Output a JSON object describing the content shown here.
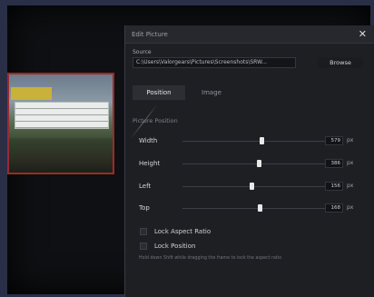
{
  "dialog": {
    "title": "Edit Picture",
    "close_icon": "close-icon",
    "source_label": "Source",
    "source_path": "C:\\Users\\Valorgears\\Pictures\\Screenshots\\SRW...",
    "browse_label": "Browse",
    "tabs": [
      {
        "label": "Position",
        "active": true
      },
      {
        "label": "Image",
        "active": false
      }
    ],
    "section_title": "Picture Position",
    "properties": [
      {
        "label": "Width",
        "value": "579",
        "unit": "px",
        "slider_fraction": 0.55
      },
      {
        "label": "Height",
        "value": "386",
        "unit": "px",
        "slider_fraction": 0.53
      },
      {
        "label": "Left",
        "value": "156",
        "unit": "px",
        "slider_fraction": 0.48
      },
      {
        "label": "Top",
        "value": "168",
        "unit": "px",
        "slider_fraction": 0.54
      }
    ],
    "checkboxes": [
      {
        "label": "Lock Aspect Ratio",
        "checked": false
      },
      {
        "label": "Lock Position",
        "checked": false
      }
    ],
    "hint": "Hold down Shift while dragging the frame to lock the aspect ratio"
  },
  "colors": {
    "background": "#2a2f48",
    "dialog_bg": "#1e1f23",
    "thumbnail_border": "#9a2b2b"
  }
}
